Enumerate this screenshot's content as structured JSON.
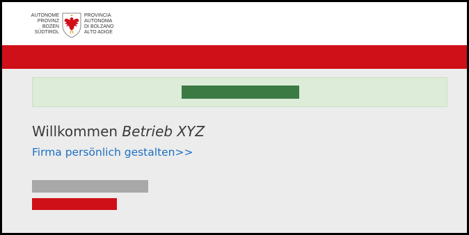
{
  "header": {
    "logo": {
      "left_lines": [
        "AUTONOME",
        "PROVINZ",
        "BOZEN",
        "SÜDTIROL"
      ],
      "right_lines": [
        "PROVINCIA",
        "AUTONOMA",
        "DI BOLZANO",
        "ALTO ADIGE"
      ],
      "emblem_icon": "eagle-coat-of-arms-icon"
    }
  },
  "colors": {
    "brand_red": "#cf1018",
    "notice_bg": "#dcecd8",
    "notice_bar": "#3c7a44",
    "link_blue": "#1d6fc2",
    "page_bg": "#ececec",
    "placeholder_gray": "#a8a8a8"
  },
  "main": {
    "welcome_prefix": "Willkommen",
    "company_name": "Betrieb XYZ",
    "personalize_link": "Firma persönlich gestalten>>"
  }
}
